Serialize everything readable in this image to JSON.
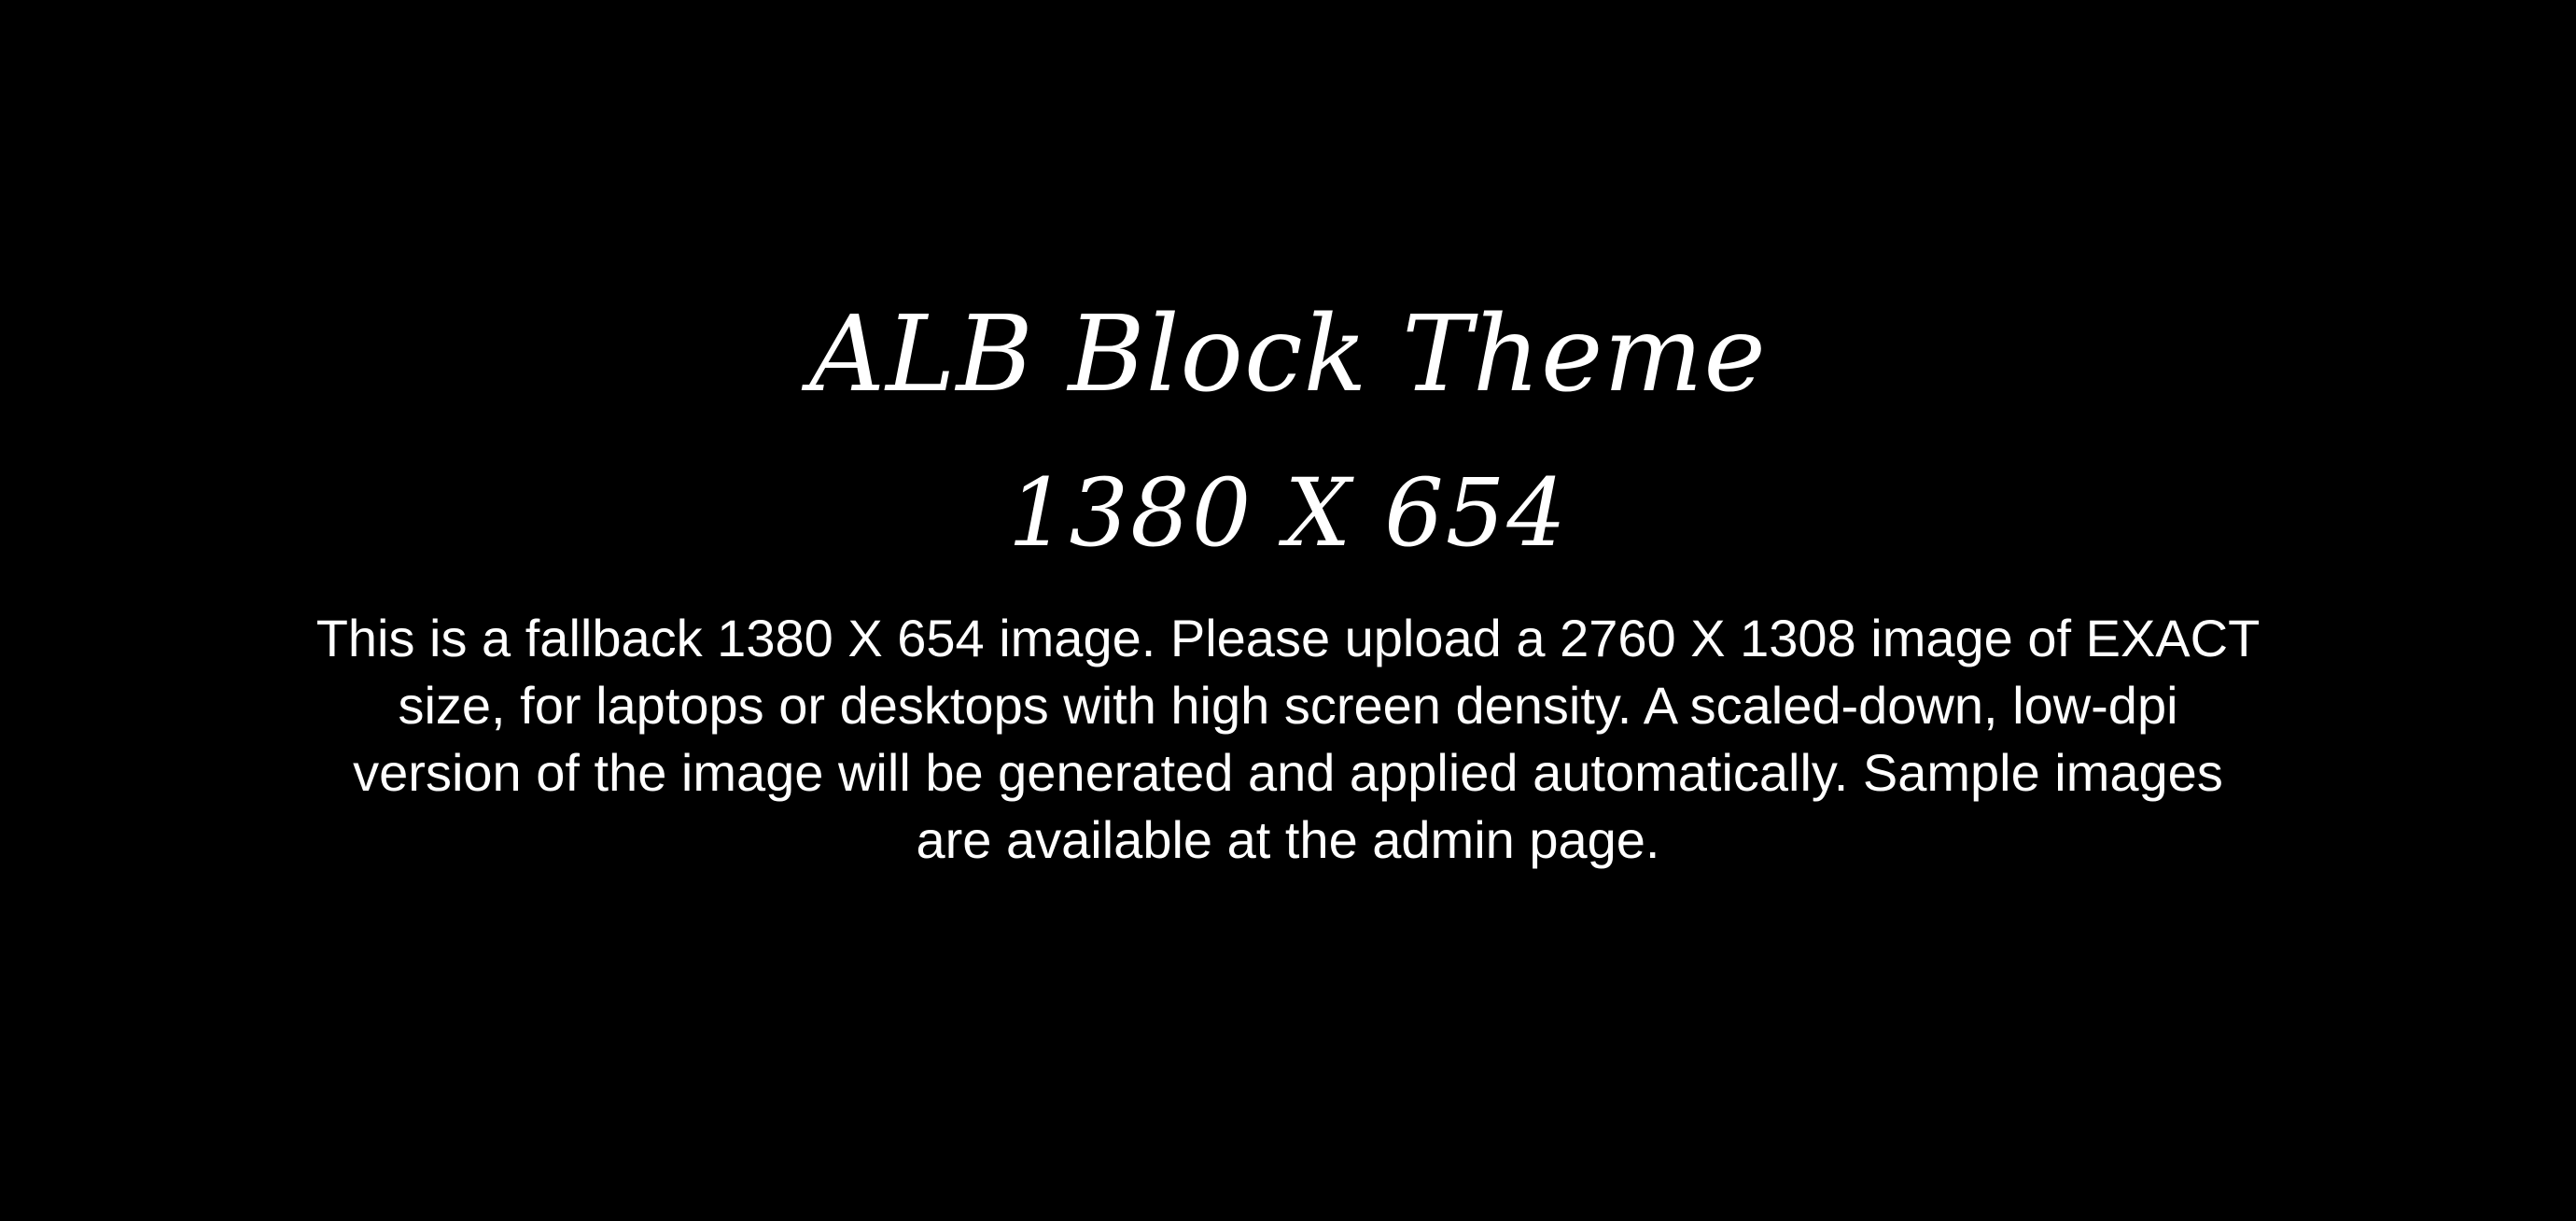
{
  "placeholder": {
    "title": "ALB Block Theme",
    "dimensions": "1380 X 654",
    "description": "This is a fallback 1380 X 654 image. Please upload a 2760 X 1308 image of EXACT size, for laptops or desktops with high screen density. A scaled-down, low-dpi version of the image will be generated and applied automatically. Sample images are available at the admin page."
  },
  "colors": {
    "background": "#000000",
    "text": "#ffffff"
  }
}
